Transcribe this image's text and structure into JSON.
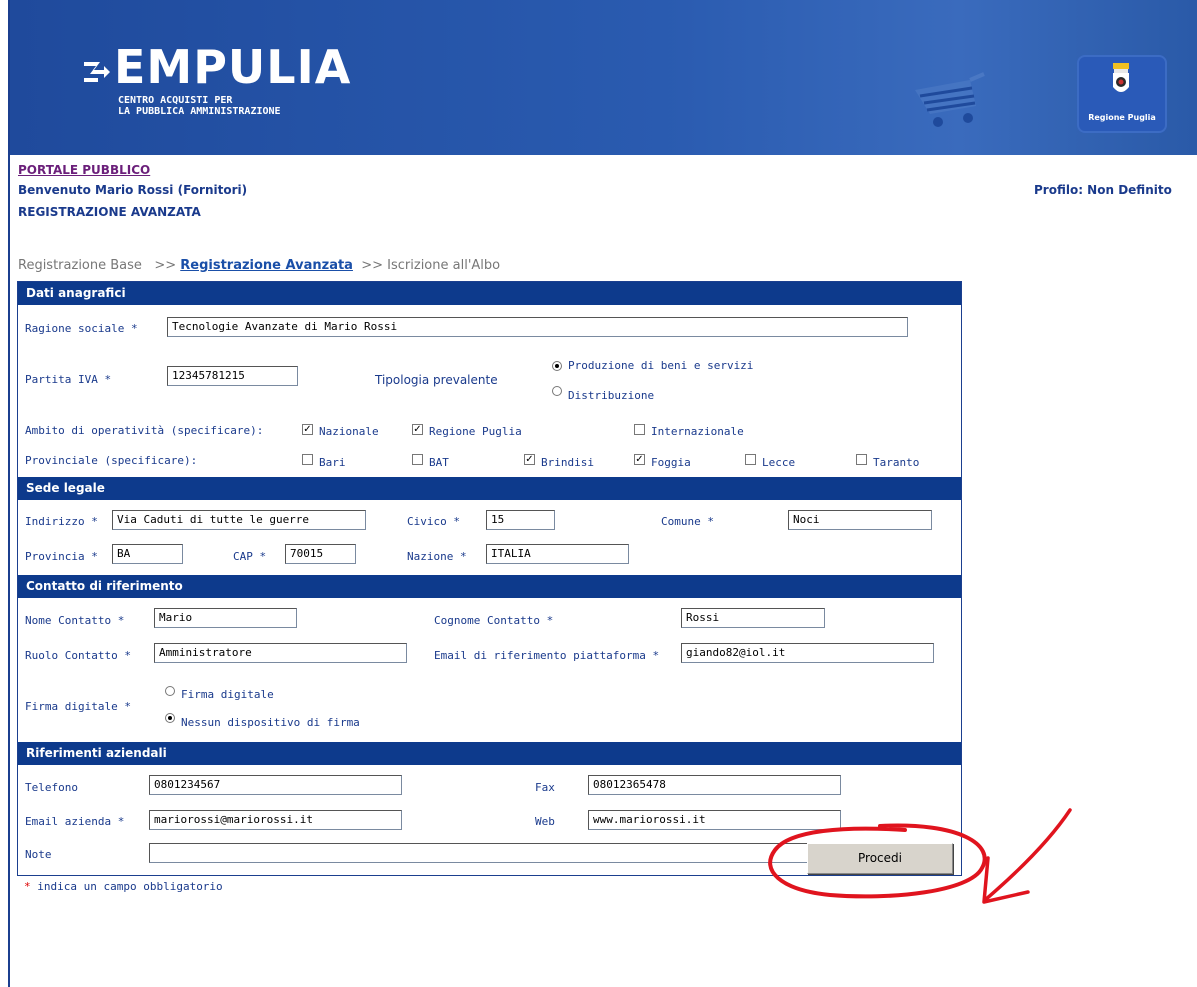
{
  "banner": {
    "logo_text": "EMPULIA",
    "logo_sub_1": "CENTRO ACQUISTI PER",
    "logo_sub_2": "LA PUBBLICA AMMINISTRAZIONE",
    "region_label": "Regione Puglia"
  },
  "header": {
    "portal_link": "PORTALE PUBBLICO",
    "welcome": "Benvenuto Mario Rossi (Fornitori)",
    "page_title": "REGISTRAZIONE AVANZATA",
    "profile": "Profilo: Non Definito"
  },
  "steps": {
    "step1": "Registrazione Base",
    "sep1": ">>",
    "step2": "Registrazione Avanzata",
    "sep2": ">>",
    "step3": "Iscrizione all'Albo"
  },
  "anagrafici": {
    "heading": "Dati anagrafici",
    "ragione_label": "Ragione sociale *",
    "ragione_value": "Tecnologie Avanzate di Mario Rossi",
    "piva_label": "Partita IVA *",
    "piva_value": "12345781215",
    "tipologia_label": "Tipologia prevalente",
    "tipologia_opt1": "Produzione di beni e servizi",
    "tipologia_opt2": "Distribuzione",
    "ambito_label": "Ambito di operatività (specificare):",
    "ambito_nazionale": "Nazionale",
    "ambito_regione": "Regione Puglia",
    "ambito_internazionale": "Internazionale",
    "provinciale_label": "Provinciale (specificare):",
    "prov_bari": "Bari",
    "prov_bat": "BAT",
    "prov_brindisi": "Brindisi",
    "prov_foggia": "Foggia",
    "prov_lecce": "Lecce",
    "prov_taranto": "Taranto"
  },
  "sede": {
    "heading": "Sede legale",
    "indirizzo_label": "Indirizzo *",
    "indirizzo_value": "Via Caduti di tutte le guerre",
    "civico_label": "Civico *",
    "civico_value": "15",
    "comune_label": "Comune *",
    "comune_value": "Noci",
    "provincia_label": "Provincia *",
    "provincia_value": "BA",
    "cap_label": "CAP *",
    "cap_value": "70015",
    "nazione_label": "Nazione *",
    "nazione_value": "ITALIA"
  },
  "contatto": {
    "heading": "Contatto di riferimento",
    "nome_label": "Nome Contatto *",
    "nome_value": "Mario",
    "cognome_label": "Cognome Contatto *",
    "cognome_value": "Rossi",
    "ruolo_label": "Ruolo Contatto *",
    "ruolo_value": "Amministratore",
    "email_label": "Email di riferimento piattaforma *",
    "email_value": "giando82@iol.it",
    "firma_label": "Firma digitale *",
    "firma_opt1": "Firma digitale",
    "firma_opt2": "Nessun dispositivo di firma"
  },
  "aziendali": {
    "heading": "Riferimenti aziendali",
    "telefono_label": "Telefono",
    "telefono_value": "0801234567",
    "fax_label": "Fax",
    "fax_value": "08012365478",
    "email_label": "Email azienda *",
    "email_value": "mariorossi@mariorossi.it",
    "web_label": "Web",
    "web_value": "www.mariorossi.it",
    "note_label": "Note",
    "note_value": ""
  },
  "footer": {
    "required_star": "*",
    "required_text": " indica un campo obbligatorio",
    "submit_label": "Procedi"
  },
  "colors": {
    "section_header": "#0d3a8c",
    "banner": "#2a5bb0",
    "annotation": "#e0141e"
  }
}
